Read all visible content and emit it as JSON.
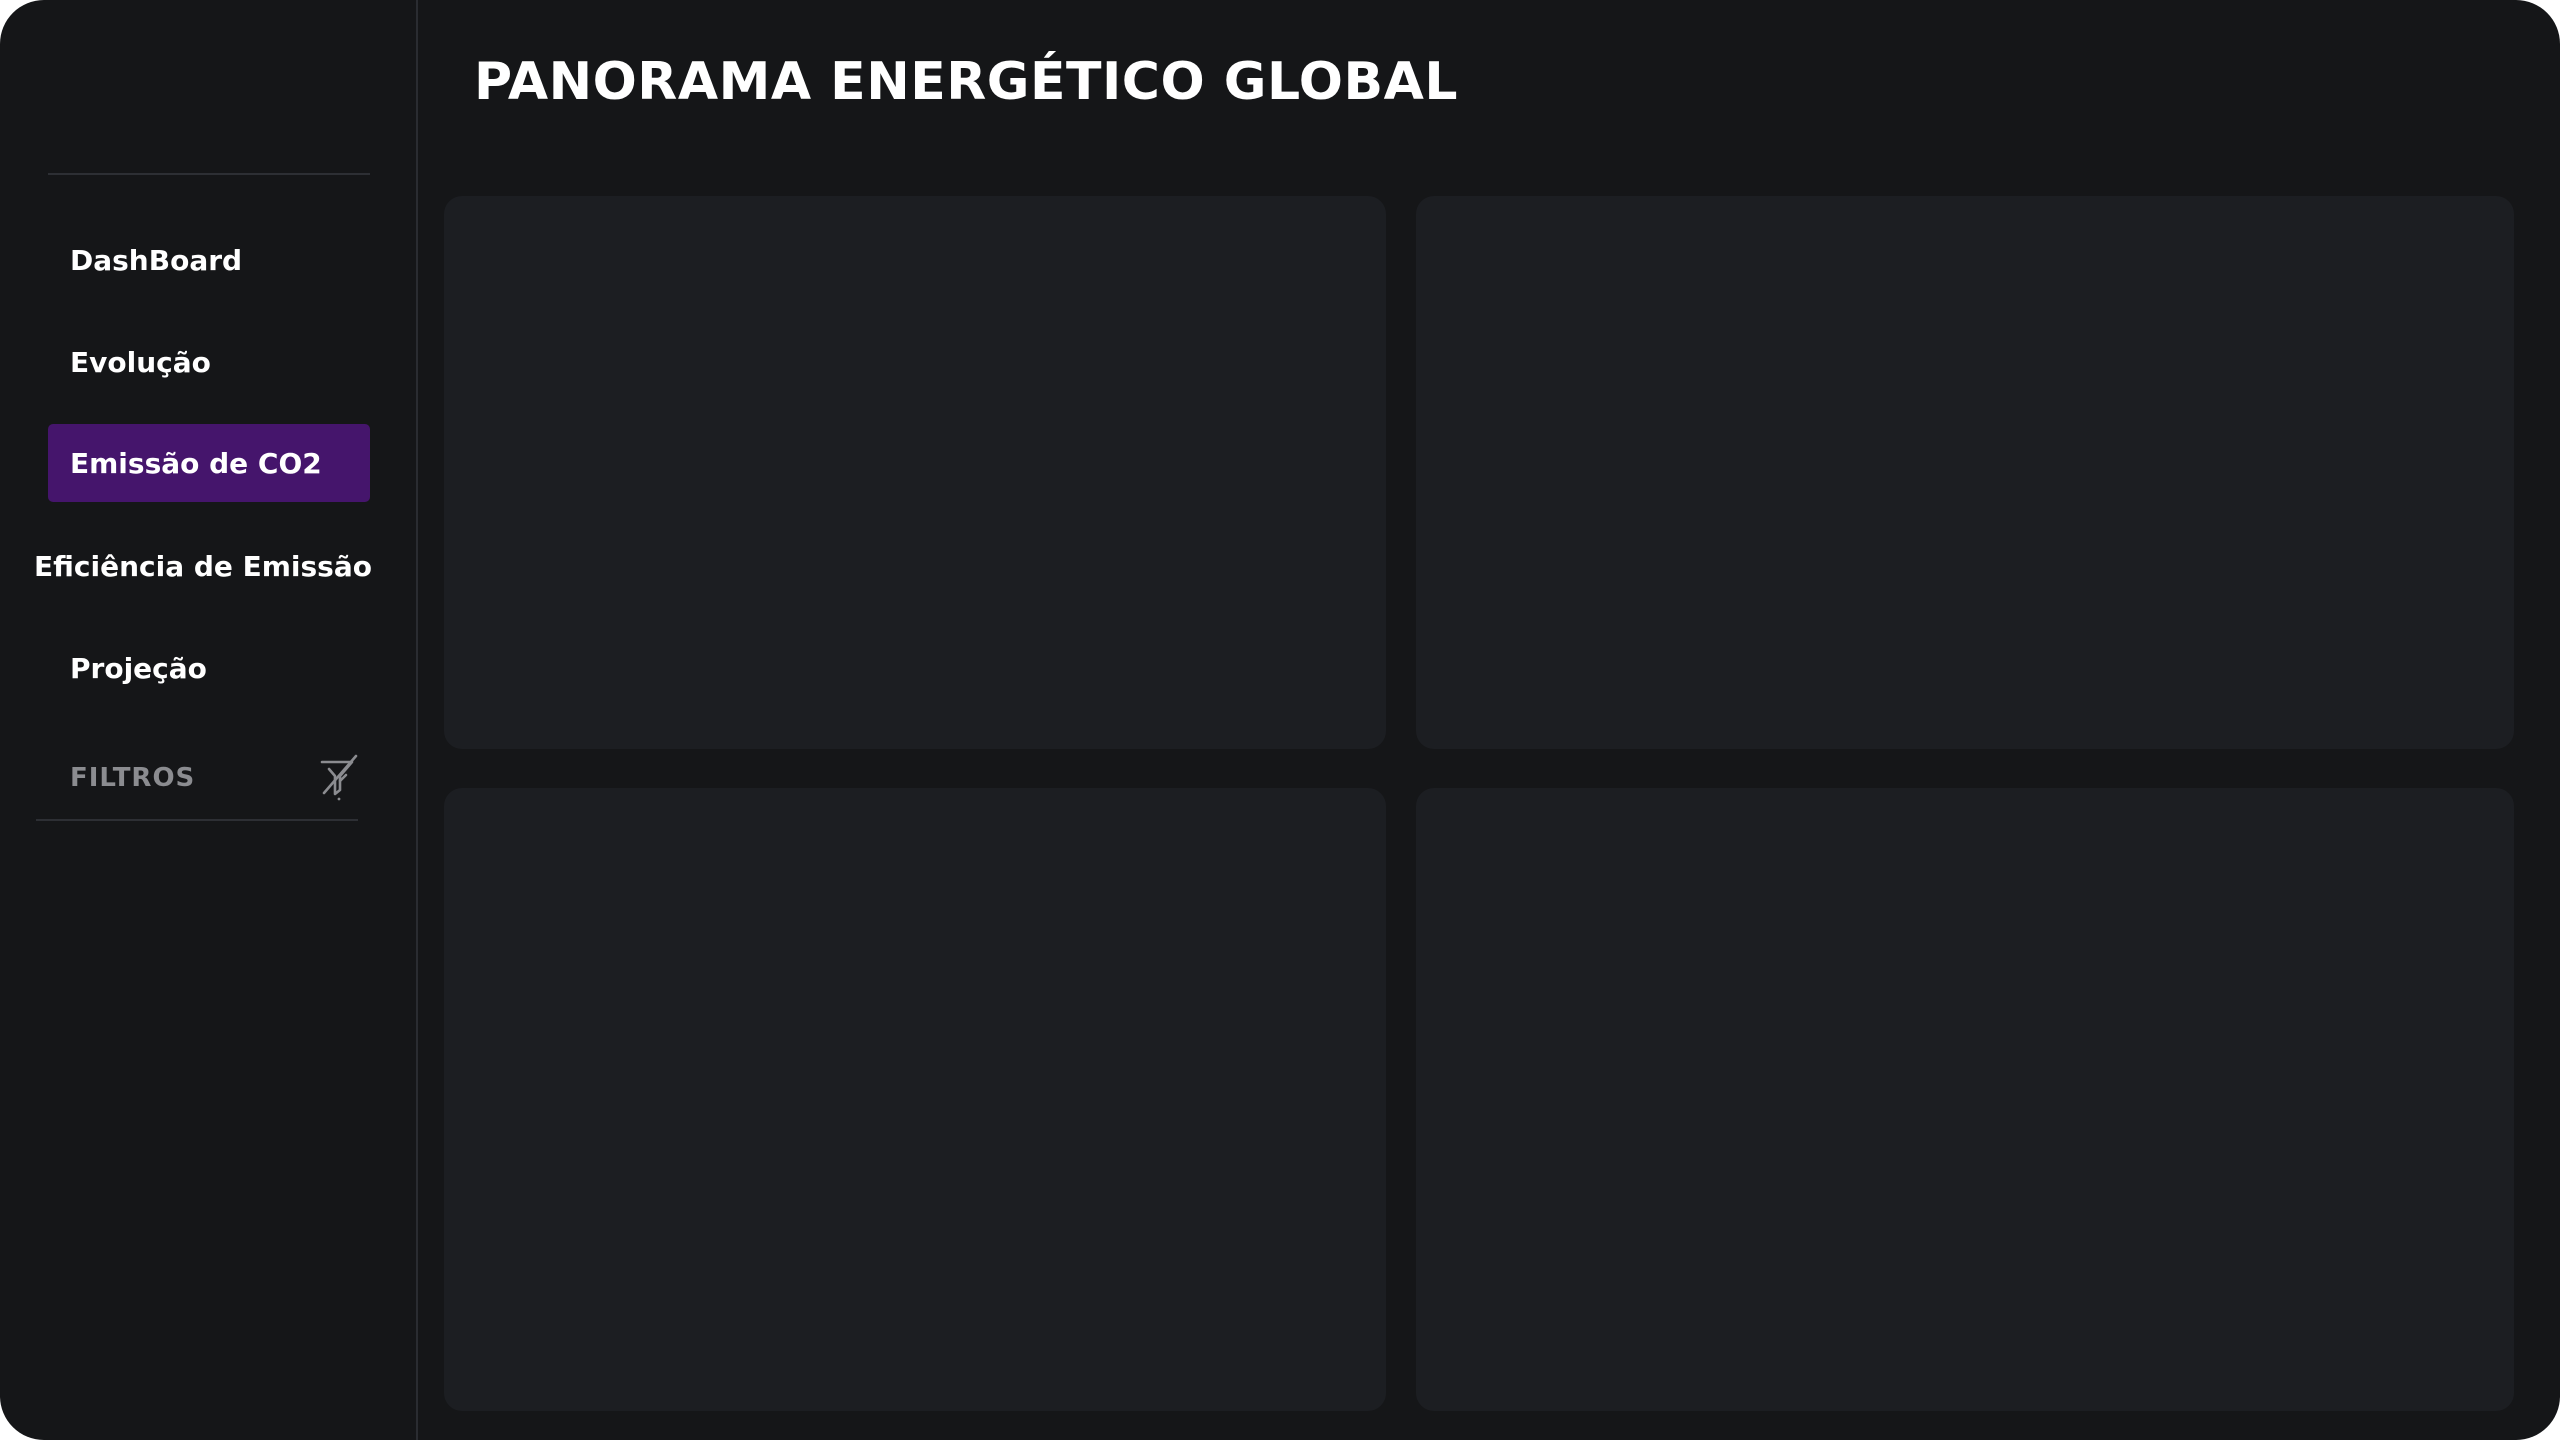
{
  "header": {
    "title": "PANORAMA ENERGÉTICO GLOBAL"
  },
  "sidebar": {
    "items": [
      {
        "label": "DashBoard",
        "active": false
      },
      {
        "label": "Evolução",
        "active": false
      },
      {
        "label": "Emissão de CO2",
        "active": true
      },
      {
        "label": "Eficiência de Emissão",
        "active": false
      },
      {
        "label": "Projeção",
        "active": false
      }
    ],
    "filters_label": "FILTROS",
    "filters_icon": "filter-off-icon"
  },
  "colors": {
    "background": "#151618",
    "card": "#1c1e22",
    "active_nav": "#45156c",
    "text": "#ffffff",
    "muted_text": "#8b8c90"
  }
}
